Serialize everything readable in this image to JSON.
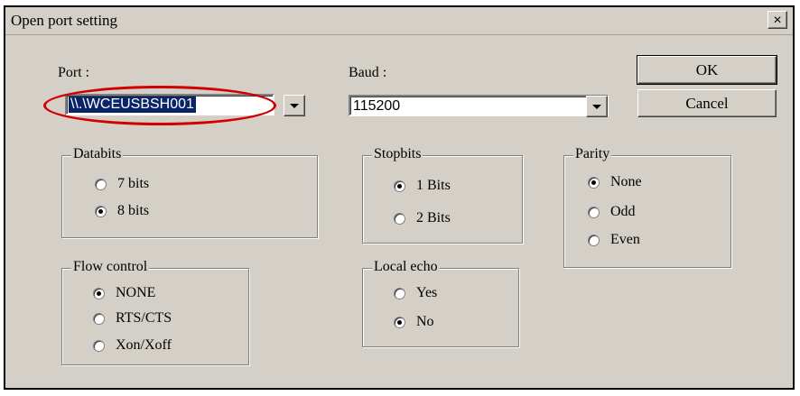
{
  "window": {
    "title": "Open port setting",
    "close_label": "×"
  },
  "port": {
    "label": "Port :",
    "value": "\\\\.\\WCEUSBSH001"
  },
  "baud": {
    "label": "Baud :",
    "value": "115200"
  },
  "buttons": {
    "ok": "OK",
    "cancel": "Cancel"
  },
  "databits": {
    "title": "Databits",
    "options": [
      "7 bits",
      "8 bits"
    ],
    "selected": "8 bits"
  },
  "stopbits": {
    "title": "Stopbits",
    "options": [
      "1 Bits",
      "2 Bits"
    ],
    "selected": "1 Bits"
  },
  "parity": {
    "title": "Parity",
    "options": [
      "None",
      "Odd",
      "Even"
    ],
    "selected": "None"
  },
  "flow_control": {
    "title": "Flow control",
    "options": [
      "NONE",
      "RTS/CTS",
      "Xon/Xoff"
    ],
    "selected": "NONE"
  },
  "local_echo": {
    "title": "Local echo",
    "options": [
      "Yes",
      "No"
    ],
    "selected": "No"
  },
  "annotation_color": "#d00000"
}
